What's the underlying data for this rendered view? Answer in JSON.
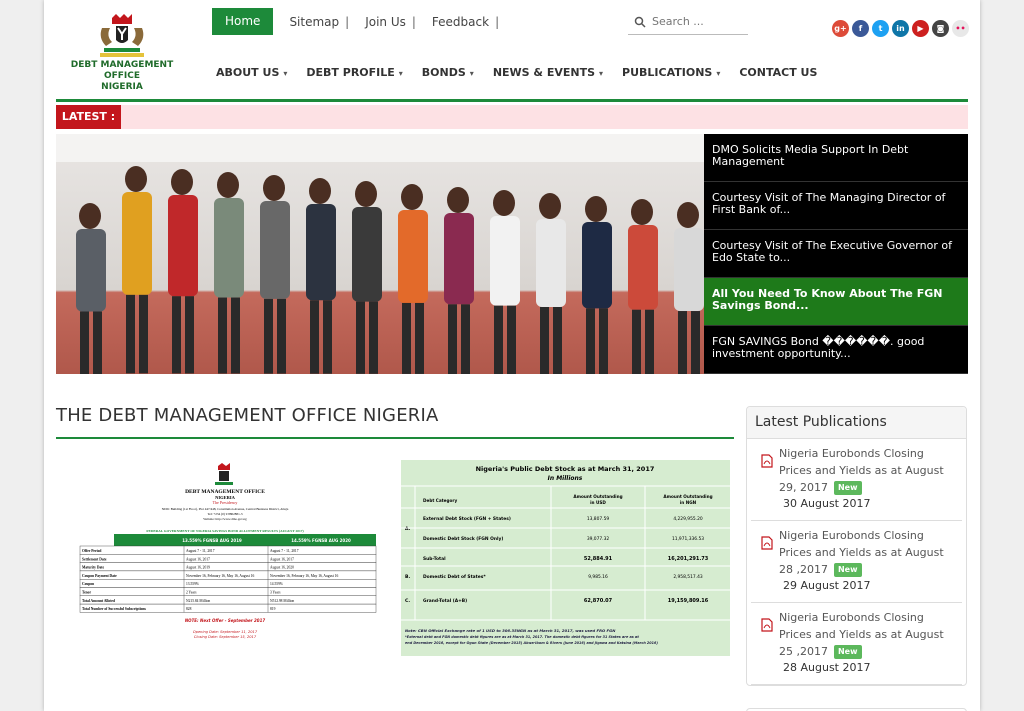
{
  "header": {
    "org_name_line1": "DEBT MANAGEMENT OFFICE",
    "org_name_line2": "NIGERIA",
    "top_links": [
      "Home",
      "Sitemap",
      "Join Us",
      "Feedback"
    ],
    "separator": "|",
    "search_placeholder": "Search ...",
    "social": [
      {
        "icon": "google-plus-icon",
        "glyph": "g+",
        "color": "#dd4b39"
      },
      {
        "icon": "facebook-icon",
        "glyph": "f",
        "color": "#3b5998"
      },
      {
        "icon": "twitter-icon",
        "glyph": "t",
        "color": "#1da1f2"
      },
      {
        "icon": "linkedin-icon",
        "glyph": "in",
        "color": "#0e76a8"
      },
      {
        "icon": "youtube-icon",
        "glyph": "▶",
        "color": "#cd201f"
      },
      {
        "icon": "instagram-icon",
        "glyph": "◙",
        "color": "#444444"
      },
      {
        "icon": "flickr-icon",
        "glyph": "••",
        "color": "#e8e8e8"
      }
    ],
    "nav": [
      {
        "label": "ABOUT US",
        "dropdown": true
      },
      {
        "label": "DEBT PROFILE",
        "dropdown": true
      },
      {
        "label": "BONDS",
        "dropdown": true
      },
      {
        "label": "NEWS & EVENTS",
        "dropdown": true
      },
      {
        "label": "PUBLICATIONS",
        "dropdown": true
      },
      {
        "label": "CONTACT US",
        "dropdown": false
      }
    ]
  },
  "latest": {
    "label": "LATEST :"
  },
  "slider": {
    "news": [
      "DMO Solicits Media Support In Debt Management",
      "Courtesy Visit of The Managing Director of First Bank of...",
      "Courtesy Visit of The Executive Governor of Edo State to...",
      "All You Need To Know About The FGN Savings Bond...",
      "FGN SAVINGS Bond ������. good investment opportunity..."
    ],
    "active_index": 3
  },
  "main": {
    "title": "THE DEBT MANAGEMENT OFFICE NIGERIA"
  },
  "doc1": {
    "org": "DEBT MANAGEMENT OFFICE",
    "country": "NIGERIA",
    "sub": "The Presidency",
    "address": "NDIC Building (1st Floor), Plot 447/448, Constitution Avenue, Central Business District, Abuja",
    "tel": "Tel: +234 (0) 9 8802881-3",
    "website": "Website: http://www.dmo.gov.ng",
    "heading": "FEDERAL GOVERNMENT OF NIGERIA SAVINGS BOND ALLOTMENT RESULTS (AUGUST 2017)",
    "col1": "13.559% FGNSB AUG 2019",
    "col2": "14.559% FGNSB AUG 2020",
    "rows": [
      [
        "Offer Period",
        "August 7 - 11, 2017",
        "August 7 - 11, 2017"
      ],
      [
        "Settlement Date",
        "August 16, 2017",
        "August 16, 2017"
      ],
      [
        "Maturity Date",
        "August 16, 2019",
        "August 16, 2020"
      ],
      [
        "Coupon Payment Date",
        "November 16, February 16, May 16, August 16",
        "November 16, February 16, May 16, August 16"
      ],
      [
        "Coupon",
        "13.559%",
        "14.559%"
      ],
      [
        "Tenor",
        "2 Years",
        "3 Years"
      ],
      [
        "Total Amount Alloted",
        "N215.84 Million",
        "N512.98 Million"
      ],
      [
        "Total Number of Successful Subscriptions",
        "828",
        "819"
      ]
    ],
    "note": "NOTE: Next Offer - September 2017",
    "opening": "Opening Date: September 11, 2017",
    "closing": "Closing Date: September 15, 2017"
  },
  "doc2": {
    "title": "Nigeria's Public Debt Stock as at March 31, 2017",
    "subtitle": "In Millions",
    "headers": [
      "Debt Category",
      "Amount Outstanding in USD",
      "Amount Outstanding in NGN"
    ],
    "rows": [
      [
        "A.",
        "External Debt Stock (FGN + States)",
        "13,807.59",
        "4,229,955.20"
      ],
      [
        "",
        "Domestic Debt Stock (FGN Only)",
        "39,077.32",
        "11,971,336.53"
      ],
      [
        "",
        "Sub-Total",
        "52,884.91",
        "16,201,291.73"
      ],
      [
        "B.",
        "Domestic Debt of States*",
        "9,985.16",
        "2,958,517.43"
      ],
      [
        "C.",
        "Grand-Total (A+B)",
        "62,870.07",
        "19,159,809.16"
      ]
    ],
    "note1": "Note: CBN Official Exchange rate of 1 USD to 306.35NGN as at March 31, 2017, was used FRO FGN",
    "note2": "*External debt and FGN domestic debt figures are as at March 31, 2017. The domestic debt figures for 31 States are as at end December 2016, except for Ogun State (December 2015) Akwa-Ibom & Rivers (June 2016) and Jigawa and Katsina (March 2016)"
  },
  "publications": {
    "heading": "Latest Publications",
    "badge": "New",
    "items": [
      {
        "title": "Nigeria Eurobonds Closing Prices and Yields as at August 29, 2017",
        "date": "30 August 2017"
      },
      {
        "title": "Nigeria Eurobonds Closing Prices and Yields as at August 28 ,2017",
        "date": "29 August 2017"
      },
      {
        "title": "Nigeria Eurobonds Closing Prices and Yields as at August 25 ,2017",
        "date": "28 August 2017"
      }
    ]
  }
}
